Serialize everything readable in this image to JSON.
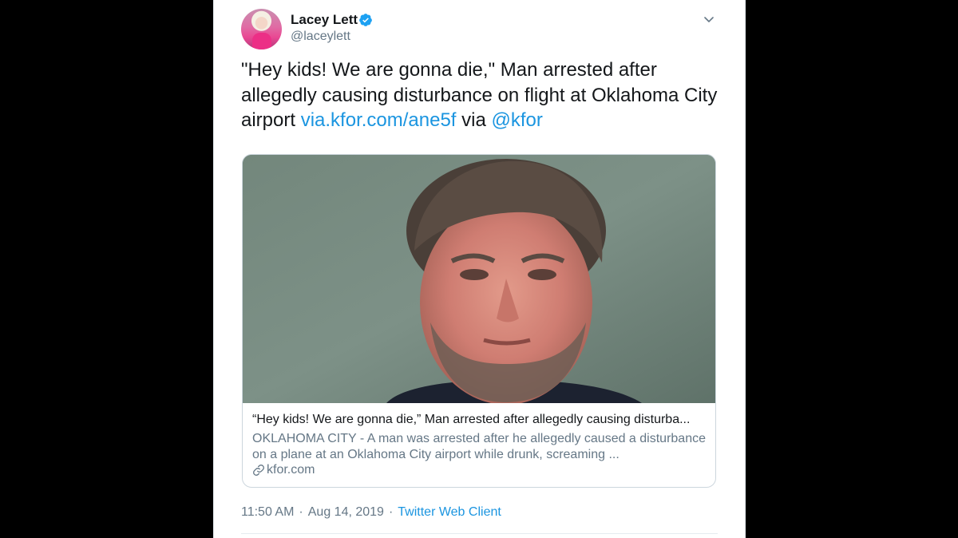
{
  "author": {
    "name": "Lacey Lett",
    "handle": "@laceylett",
    "verified": true
  },
  "tweet": {
    "text_prefix": "\"Hey kids! We are gonna die,\" Man arrested after allegedly causing disturbance on flight at Oklahoma City airport ",
    "link": "via.kfor.com/ane5f",
    "text_middle": " via ",
    "mention": "@kfor"
  },
  "card": {
    "title": "“Hey kids! We are gonna die,” Man arrested after allegedly causing disturba...",
    "description": "OKLAHOMA CITY - A man was arrested after he allegedly caused a disturbance on a plane at an Oklahoma City airport while drunk, screaming ...",
    "domain": "kfor.com",
    "image_alt": "mugshot-photo"
  },
  "meta": {
    "time": "11:50 AM",
    "date": "Aug 14, 2019",
    "separator": "·",
    "client": "Twitter Web Client"
  },
  "colors": {
    "link": "#1b95e0",
    "secondary_text": "#657786",
    "primary_text": "#14171a",
    "verified_badge": "#1da1f2"
  },
  "icons": {
    "verified": "verified-badge-icon",
    "caret": "chevron-down-icon",
    "link": "link-icon"
  }
}
